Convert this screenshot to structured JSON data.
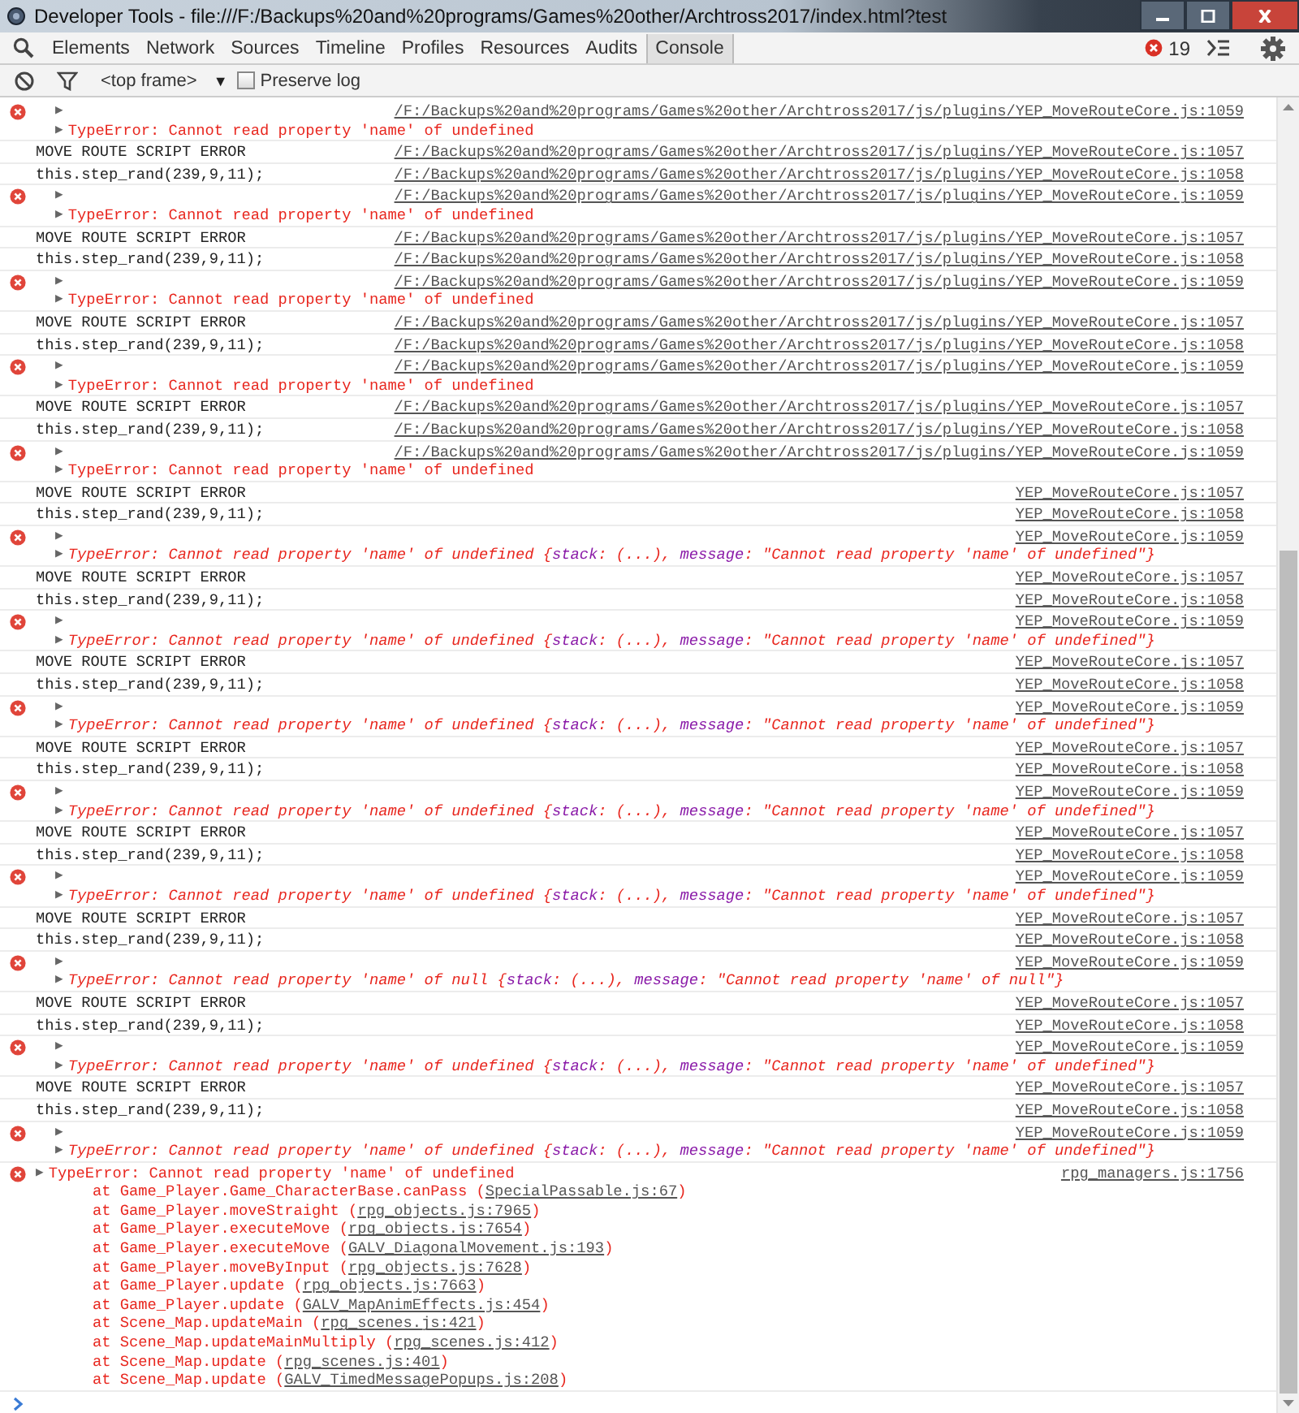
{
  "window": {
    "title": "Developer Tools - file:///F:/Backups%20and%20programs/Games%20other/Archtross2017/index.html?test"
  },
  "tabs": [
    {
      "label": "Elements",
      "selected": false
    },
    {
      "label": "Network",
      "selected": false
    },
    {
      "label": "Sources",
      "selected": false
    },
    {
      "label": "Timeline",
      "selected": false
    },
    {
      "label": "Profiles",
      "selected": false
    },
    {
      "label": "Resources",
      "selected": false
    },
    {
      "label": "Audits",
      "selected": false
    },
    {
      "label": "Console",
      "selected": true
    }
  ],
  "error_count": "19",
  "filter_bar": {
    "context": "<top frame>",
    "context_caret": "▼",
    "preserve_log": {
      "label": "Preserve log",
      "checked": false
    }
  },
  "messages": [
    {
      "kind": "error",
      "toggle": "▶",
      "source": "/F:/Backups%20and%20programs/Games%20other/Archtross2017/js/plugins/YEP_MoveRouteCore.js:1059",
      "summary_toggle": "▶",
      "summary": "TypeError: Cannot read property 'name' of undefined"
    },
    {
      "kind": "log",
      "text": "MOVE ROUTE SCRIPT ERROR",
      "source": "/F:/Backups%20and%20programs/Games%20other/Archtross2017/js/plugins/YEP_MoveRouteCore.js:1057"
    },
    {
      "kind": "log",
      "text": "this.step_rand(239,9,11);",
      "source": "/F:/Backups%20and%20programs/Games%20other/Archtross2017/js/plugins/YEP_MoveRouteCore.js:1058"
    },
    {
      "kind": "error",
      "toggle": "▶",
      "source": "/F:/Backups%20and%20programs/Games%20other/Archtross2017/js/plugins/YEP_MoveRouteCore.js:1059",
      "summary_toggle": "▶",
      "summary": "TypeError: Cannot read property 'name' of undefined"
    },
    {
      "kind": "log",
      "text": "MOVE ROUTE SCRIPT ERROR",
      "source": "/F:/Backups%20and%20programs/Games%20other/Archtross2017/js/plugins/YEP_MoveRouteCore.js:1057"
    },
    {
      "kind": "log",
      "text": "this.step_rand(239,9,11);",
      "source": "/F:/Backups%20and%20programs/Games%20other/Archtross2017/js/plugins/YEP_MoveRouteCore.js:1058"
    },
    {
      "kind": "error",
      "toggle": "▶",
      "source": "/F:/Backups%20and%20programs/Games%20other/Archtross2017/js/plugins/YEP_MoveRouteCore.js:1059",
      "summary_toggle": "▶",
      "summary": "TypeError: Cannot read property 'name' of undefined"
    },
    {
      "kind": "log",
      "text": "MOVE ROUTE SCRIPT ERROR",
      "source": "/F:/Backups%20and%20programs/Games%20other/Archtross2017/js/plugins/YEP_MoveRouteCore.js:1057"
    },
    {
      "kind": "log",
      "text": "this.step_rand(239,9,11);",
      "source": "/F:/Backups%20and%20programs/Games%20other/Archtross2017/js/plugins/YEP_MoveRouteCore.js:1058"
    },
    {
      "kind": "error",
      "toggle": "▶",
      "source": "/F:/Backups%20and%20programs/Games%20other/Archtross2017/js/plugins/YEP_MoveRouteCore.js:1059",
      "summary_toggle": "▶",
      "summary": "TypeError: Cannot read property 'name' of undefined"
    },
    {
      "kind": "log",
      "text": "MOVE ROUTE SCRIPT ERROR",
      "source": "/F:/Backups%20and%20programs/Games%20other/Archtross2017/js/plugins/YEP_MoveRouteCore.js:1057"
    },
    {
      "kind": "log",
      "text": "this.step_rand(239,9,11);",
      "source": "/F:/Backups%20and%20programs/Games%20other/Archtross2017/js/plugins/YEP_MoveRouteCore.js:1058"
    },
    {
      "kind": "error",
      "toggle": "▶",
      "source": "/F:/Backups%20and%20programs/Games%20other/Archtross2017/js/plugins/YEP_MoveRouteCore.js:1059",
      "summary_toggle": "▶",
      "summary": "TypeError: Cannot read property 'name' of undefined"
    },
    {
      "kind": "log",
      "text": "MOVE ROUTE SCRIPT ERROR",
      "source": "YEP_MoveRouteCore.js:1057"
    },
    {
      "kind": "log",
      "text": "this.step_rand(239,9,11);",
      "source": "YEP_MoveRouteCore.js:1058"
    },
    {
      "kind": "error",
      "toggle": "▶",
      "source": "YEP_MoveRouteCore.js:1059",
      "summary_toggle": "▶",
      "summary": "TypeError: Cannot read property 'name' of undefined",
      "object": [
        {
          "kind": "punct",
          "text": " {"
        },
        {
          "kind": "key",
          "text": "stack"
        },
        {
          "kind": "punct",
          "text": ": (...), "
        },
        {
          "kind": "key",
          "text": "message"
        },
        {
          "kind": "punct",
          "text": ": \"Cannot read property 'name' of undefined\"}"
        }
      ]
    },
    {
      "kind": "log",
      "text": "MOVE ROUTE SCRIPT ERROR",
      "source": "YEP_MoveRouteCore.js:1057"
    },
    {
      "kind": "log",
      "text": "this.step_rand(239,9,11);",
      "source": "YEP_MoveRouteCore.js:1058"
    },
    {
      "kind": "error",
      "toggle": "▶",
      "source": "YEP_MoveRouteCore.js:1059",
      "summary_toggle": "▶",
      "summary": "TypeError: Cannot read property 'name' of undefined",
      "object": [
        {
          "kind": "punct",
          "text": " {"
        },
        {
          "kind": "key",
          "text": "stack"
        },
        {
          "kind": "punct",
          "text": ": (...), "
        },
        {
          "kind": "key",
          "text": "message"
        },
        {
          "kind": "punct",
          "text": ": \"Cannot read property 'name' of undefined\"}"
        }
      ]
    },
    {
      "kind": "log",
      "text": "MOVE ROUTE SCRIPT ERROR",
      "source": "YEP_MoveRouteCore.js:1057"
    },
    {
      "kind": "log",
      "text": "this.step_rand(239,9,11);",
      "source": "YEP_MoveRouteCore.js:1058"
    },
    {
      "kind": "error",
      "toggle": "▶",
      "source": "YEP_MoveRouteCore.js:1059",
      "summary_toggle": "▶",
      "summary": "TypeError: Cannot read property 'name' of undefined",
      "object": [
        {
          "kind": "punct",
          "text": " {"
        },
        {
          "kind": "key",
          "text": "stack"
        },
        {
          "kind": "punct",
          "text": ": (...), "
        },
        {
          "kind": "key",
          "text": "message"
        },
        {
          "kind": "punct",
          "text": ": \"Cannot read property 'name' of undefined\"}"
        }
      ]
    },
    {
      "kind": "log",
      "text": "MOVE ROUTE SCRIPT ERROR",
      "source": "YEP_MoveRouteCore.js:1057"
    },
    {
      "kind": "log",
      "text": "this.step_rand(239,9,11);",
      "source": "YEP_MoveRouteCore.js:1058"
    },
    {
      "kind": "error",
      "toggle": "▶",
      "source": "YEP_MoveRouteCore.js:1059",
      "summary_toggle": "▶",
      "summary": "TypeError: Cannot read property 'name' of undefined",
      "object": [
        {
          "kind": "punct",
          "text": " {"
        },
        {
          "kind": "key",
          "text": "stack"
        },
        {
          "kind": "punct",
          "text": ": (...), "
        },
        {
          "kind": "key",
          "text": "message"
        },
        {
          "kind": "punct",
          "text": ": \"Cannot read property 'name' of undefined\"}"
        }
      ]
    },
    {
      "kind": "log",
      "text": "MOVE ROUTE SCRIPT ERROR",
      "source": "YEP_MoveRouteCore.js:1057"
    },
    {
      "kind": "log",
      "text": "this.step_rand(239,9,11);",
      "source": "YEP_MoveRouteCore.js:1058"
    },
    {
      "kind": "error",
      "toggle": "▶",
      "source": "YEP_MoveRouteCore.js:1059",
      "summary_toggle": "▶",
      "summary": "TypeError: Cannot read property 'name' of undefined",
      "object": [
        {
          "kind": "punct",
          "text": " {"
        },
        {
          "kind": "key",
          "text": "stack"
        },
        {
          "kind": "punct",
          "text": ": (...), "
        },
        {
          "kind": "key",
          "text": "message"
        },
        {
          "kind": "punct",
          "text": ": \"Cannot read property 'name' of undefined\"}"
        }
      ]
    },
    {
      "kind": "log",
      "text": "MOVE ROUTE SCRIPT ERROR",
      "source": "YEP_MoveRouteCore.js:1057"
    },
    {
      "kind": "log",
      "text": "this.step_rand(239,9,11);",
      "source": "YEP_MoveRouteCore.js:1058"
    },
    {
      "kind": "error",
      "toggle": "▶",
      "source": "YEP_MoveRouteCore.js:1059",
      "summary_toggle": "▶",
      "summary": "TypeError: Cannot read property 'name' of null",
      "object": [
        {
          "kind": "punct",
          "text": " {"
        },
        {
          "kind": "key",
          "text": "stack"
        },
        {
          "kind": "punct",
          "text": ": (...), "
        },
        {
          "kind": "key",
          "text": "message"
        },
        {
          "kind": "punct",
          "text": ": \"Cannot read property 'name' of null\"}"
        }
      ]
    },
    {
      "kind": "log",
      "text": "MOVE ROUTE SCRIPT ERROR",
      "source": "YEP_MoveRouteCore.js:1057"
    },
    {
      "kind": "log",
      "text": "this.step_rand(239,9,11);",
      "source": "YEP_MoveRouteCore.js:1058"
    },
    {
      "kind": "error",
      "toggle": "▶",
      "source": "YEP_MoveRouteCore.js:1059",
      "summary_toggle": "▶",
      "summary": "TypeError: Cannot read property 'name' of undefined",
      "object": [
        {
          "kind": "punct",
          "text": " {"
        },
        {
          "kind": "key",
          "text": "stack"
        },
        {
          "kind": "punct",
          "text": ": (...), "
        },
        {
          "kind": "key",
          "text": "message"
        },
        {
          "kind": "punct",
          "text": ": \"Cannot read property 'name' of undefined\"}"
        }
      ]
    },
    {
      "kind": "log",
      "text": "MOVE ROUTE SCRIPT ERROR",
      "source": "YEP_MoveRouteCore.js:1057"
    },
    {
      "kind": "log",
      "text": "this.step_rand(239,9,11);",
      "source": "YEP_MoveRouteCore.js:1058"
    },
    {
      "kind": "error",
      "toggle": "▶",
      "source": "YEP_MoveRouteCore.js:1059",
      "summary_toggle": "▶",
      "summary": "TypeError: Cannot read property 'name' of undefined",
      "object": [
        {
          "kind": "punct",
          "text": " {"
        },
        {
          "kind": "key",
          "text": "stack"
        },
        {
          "kind": "punct",
          "text": ": (...), "
        },
        {
          "kind": "key",
          "text": "message"
        },
        {
          "kind": "punct",
          "text": ": \"Cannot read property 'name' of undefined\"}"
        }
      ]
    },
    {
      "kind": "trace",
      "summary_toggle": "▶",
      "summary": "TypeError: Cannot read property 'name' of undefined",
      "source": "rpg_managers.js:1756",
      "frames": [
        {
          "text": "at Game_Player.Game_CharacterBase.canPass (",
          "source": "SpecialPassable.js:67",
          "end": ")"
        },
        {
          "text": "at Game_Player.moveStraight (",
          "source": "rpg_objects.js:7965",
          "end": ")"
        },
        {
          "text": "at Game_Player.executeMove (",
          "source": "rpg_objects.js:7654",
          "end": ")"
        },
        {
          "text": "at Game_Player.executeMove (",
          "source": "GALV_DiagonalMovement.js:193",
          "end": ")"
        },
        {
          "text": "at Game_Player.moveByInput (",
          "source": "rpg_objects.js:7628",
          "end": ")"
        },
        {
          "text": "at Game_Player.update (",
          "source": "rpg_objects.js:7663",
          "end": ")"
        },
        {
          "text": "at Game_Player.update (",
          "source": "GALV_MapAnimEffects.js:454",
          "end": ")"
        },
        {
          "text": "at Scene_Map.updateMain (",
          "source": "rpg_scenes.js:421",
          "end": ")"
        },
        {
          "text": "at Scene_Map.updateMainMultiply (",
          "source": "rpg_scenes.js:412",
          "end": ")"
        },
        {
          "text": "at Scene_Map.update (",
          "source": "rpg_scenes.js:401",
          "end": ")"
        },
        {
          "text": "at Scene_Map.update (",
          "source": "GALV_TimedMessagePopups.js:208",
          "end": ")"
        }
      ]
    }
  ]
}
